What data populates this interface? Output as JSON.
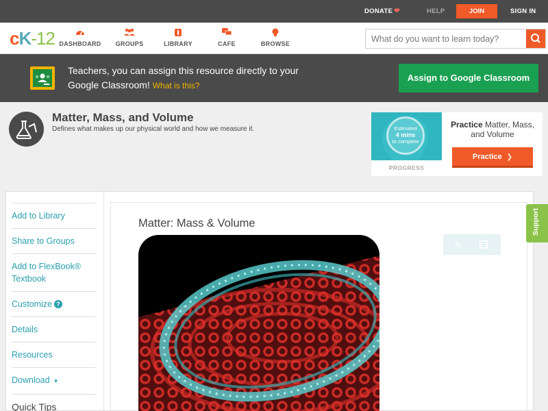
{
  "topbar": {
    "donate": "DONATE",
    "help": "HELP",
    "join": "JOIN",
    "signin": "SIGN IN"
  },
  "nav": {
    "logo": {
      "c": "c",
      "k": "K",
      "n": "-12"
    },
    "items": [
      {
        "label": "DASHBOARD",
        "icon": "dashboard-icon"
      },
      {
        "label": "GROUPS",
        "icon": "groups-icon"
      },
      {
        "label": "LIBRARY",
        "icon": "library-icon"
      },
      {
        "label": "CAFE",
        "icon": "cafe-icon"
      },
      {
        "label": "BROWSE",
        "icon": "browse-icon"
      }
    ],
    "search_placeholder": "What do you want to learn today?"
  },
  "banner": {
    "text": "Teachers, you can assign this resource directly to your Google Classroom!",
    "what_link": "What is this?",
    "assign_button": "Assign to Google Classroom"
  },
  "concept": {
    "title": "Matter, Mass, and Volume",
    "description": "Defines what makes up our physical world and how we measure it."
  },
  "practice": {
    "estimated": "Estimated",
    "mins": "4 mins",
    "complete": "to complete",
    "progress_label": "PROGRESS",
    "title_bold": "Practice",
    "title_rest": "Matter, Mass, and Volume",
    "button": "Practice"
  },
  "sidebar": {
    "items": [
      "Add to Library",
      "Share to Groups",
      "Add to FlexBook® Textbook",
      "Customize",
      "Details",
      "Resources",
      "Download",
      "Quick Tips"
    ]
  },
  "content": {
    "title": "Matter: Mass & Volume"
  },
  "support": "Support",
  "colors": {
    "brand_orange": "#f05a28",
    "teal": "#2a9fb0",
    "green": "#1aa051",
    "support_green": "#8bc34a",
    "dark": "#4a4a4a"
  }
}
